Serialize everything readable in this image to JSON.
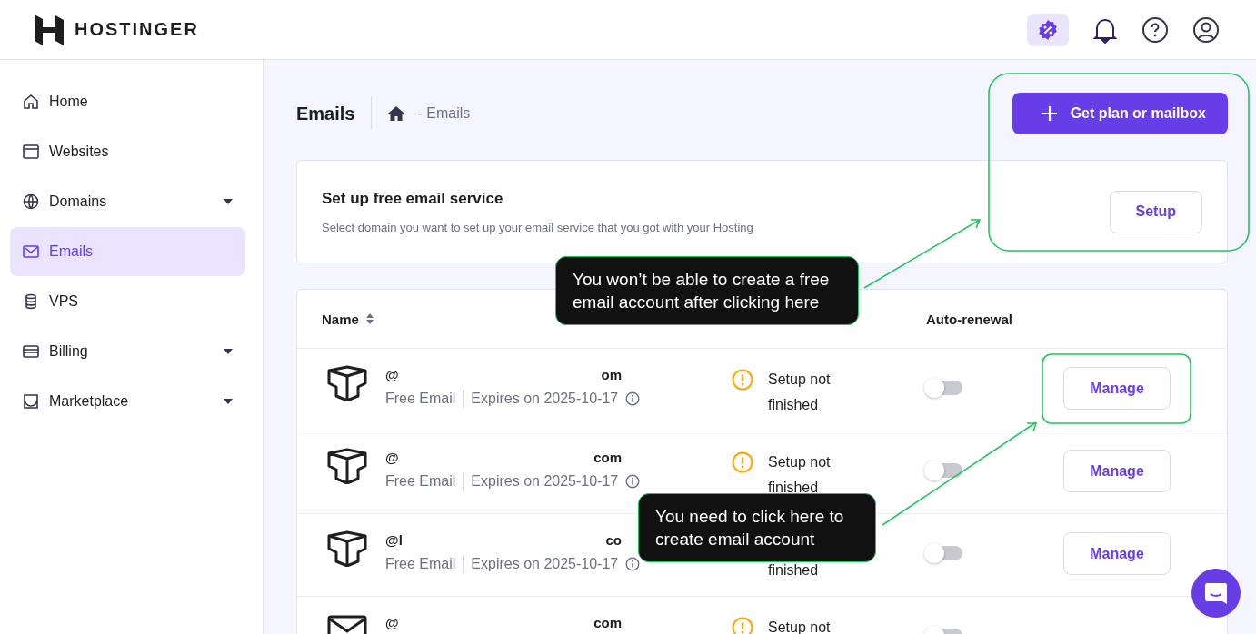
{
  "header": {
    "logo": "HOSTINGER"
  },
  "sidebar": {
    "items": [
      {
        "label": "Home",
        "expandable": false,
        "selected": false
      },
      {
        "label": "Websites",
        "expandable": false,
        "selected": false
      },
      {
        "label": "Domains",
        "expandable": true,
        "selected": false
      },
      {
        "label": "Emails",
        "expandable": false,
        "selected": true
      },
      {
        "label": "VPS",
        "expandable": false,
        "selected": false
      },
      {
        "label": "Billing",
        "expandable": true,
        "selected": false
      },
      {
        "label": "Marketplace",
        "expandable": true,
        "selected": false
      }
    ]
  },
  "page": {
    "title": "Emails",
    "breadcrumb": "- Emails",
    "primary_button": "Get plan or mailbox"
  },
  "setup_card": {
    "title": "Set up free email service",
    "description": "Select domain you want to set up your email service that you got with your Hosting",
    "button": "Setup"
  },
  "table": {
    "columns": [
      {
        "label": "Name",
        "sortable": true
      },
      {
        "label": "Auto-renewal",
        "sortable": false
      }
    ],
    "rows": [
      {
        "kind": "free",
        "name_start": "@",
        "name_end": "om",
        "plan": "Free Email",
        "expiry": "Expires on 2025-10-17",
        "status": "Setup not finished",
        "status_first_line_covered": false,
        "auto_renewal": false,
        "action": "Manage"
      },
      {
        "kind": "free",
        "name_start": "@",
        "name_end": "com",
        "plan": "Free Email",
        "expiry": "Expires on 2025-10-17",
        "status": "Setup not finished",
        "status_first_line_covered": false,
        "auto_renewal": false,
        "action": "Manage"
      },
      {
        "kind": "free",
        "name_start": "@l",
        "name_end": "co",
        "plan": "Free Email",
        "expiry": "Expires on 2025-10-17",
        "status": "finished",
        "status_first_line_covered": true,
        "auto_renewal": false,
        "action": "Manage"
      },
      {
        "kind": "mail",
        "name_start": "@",
        "name_end": "com",
        "status": "Setup not",
        "status_first_line_covered": false,
        "auto_renewal": false
      }
    ]
  },
  "annotations": [
    {
      "text": "You won’t be able to create a free email account after clicking here"
    },
    {
      "text": "You need to click here to create email account"
    }
  ]
}
